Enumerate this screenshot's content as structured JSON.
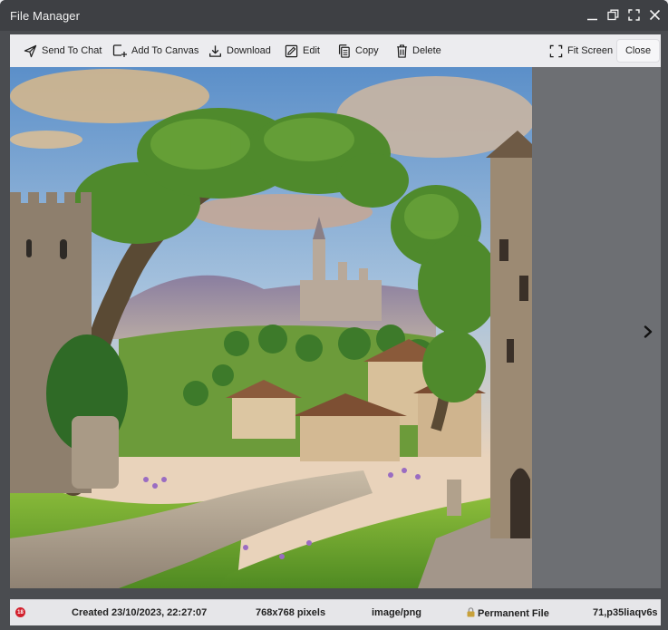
{
  "window": {
    "title": "File Manager"
  },
  "toolbar": {
    "send_to_chat": "Send To Chat",
    "add_to_canvas": "Add To Canvas",
    "download": "Download",
    "edit": "Edit",
    "copy": "Copy",
    "delete": "Delete",
    "fit_screen": "Fit Screen",
    "close": "Close"
  },
  "viewer": {
    "image_alt": "Fantasy village with castle framed by an arching tree",
    "next_icon": "chevron-right-icon"
  },
  "status": {
    "badge": "18",
    "created": "Created 23/10/2023, 22:27:07",
    "dimensions": "768x768 pixels",
    "mime": "image/png",
    "permanence": "Permanent File",
    "file_id": "71,p35liaqv6s"
  },
  "colors": {
    "titlebar": "#3e4044",
    "toolbar": "#ececef",
    "viewer_bg": "#6d6f73",
    "badge": "#d21f2c"
  }
}
